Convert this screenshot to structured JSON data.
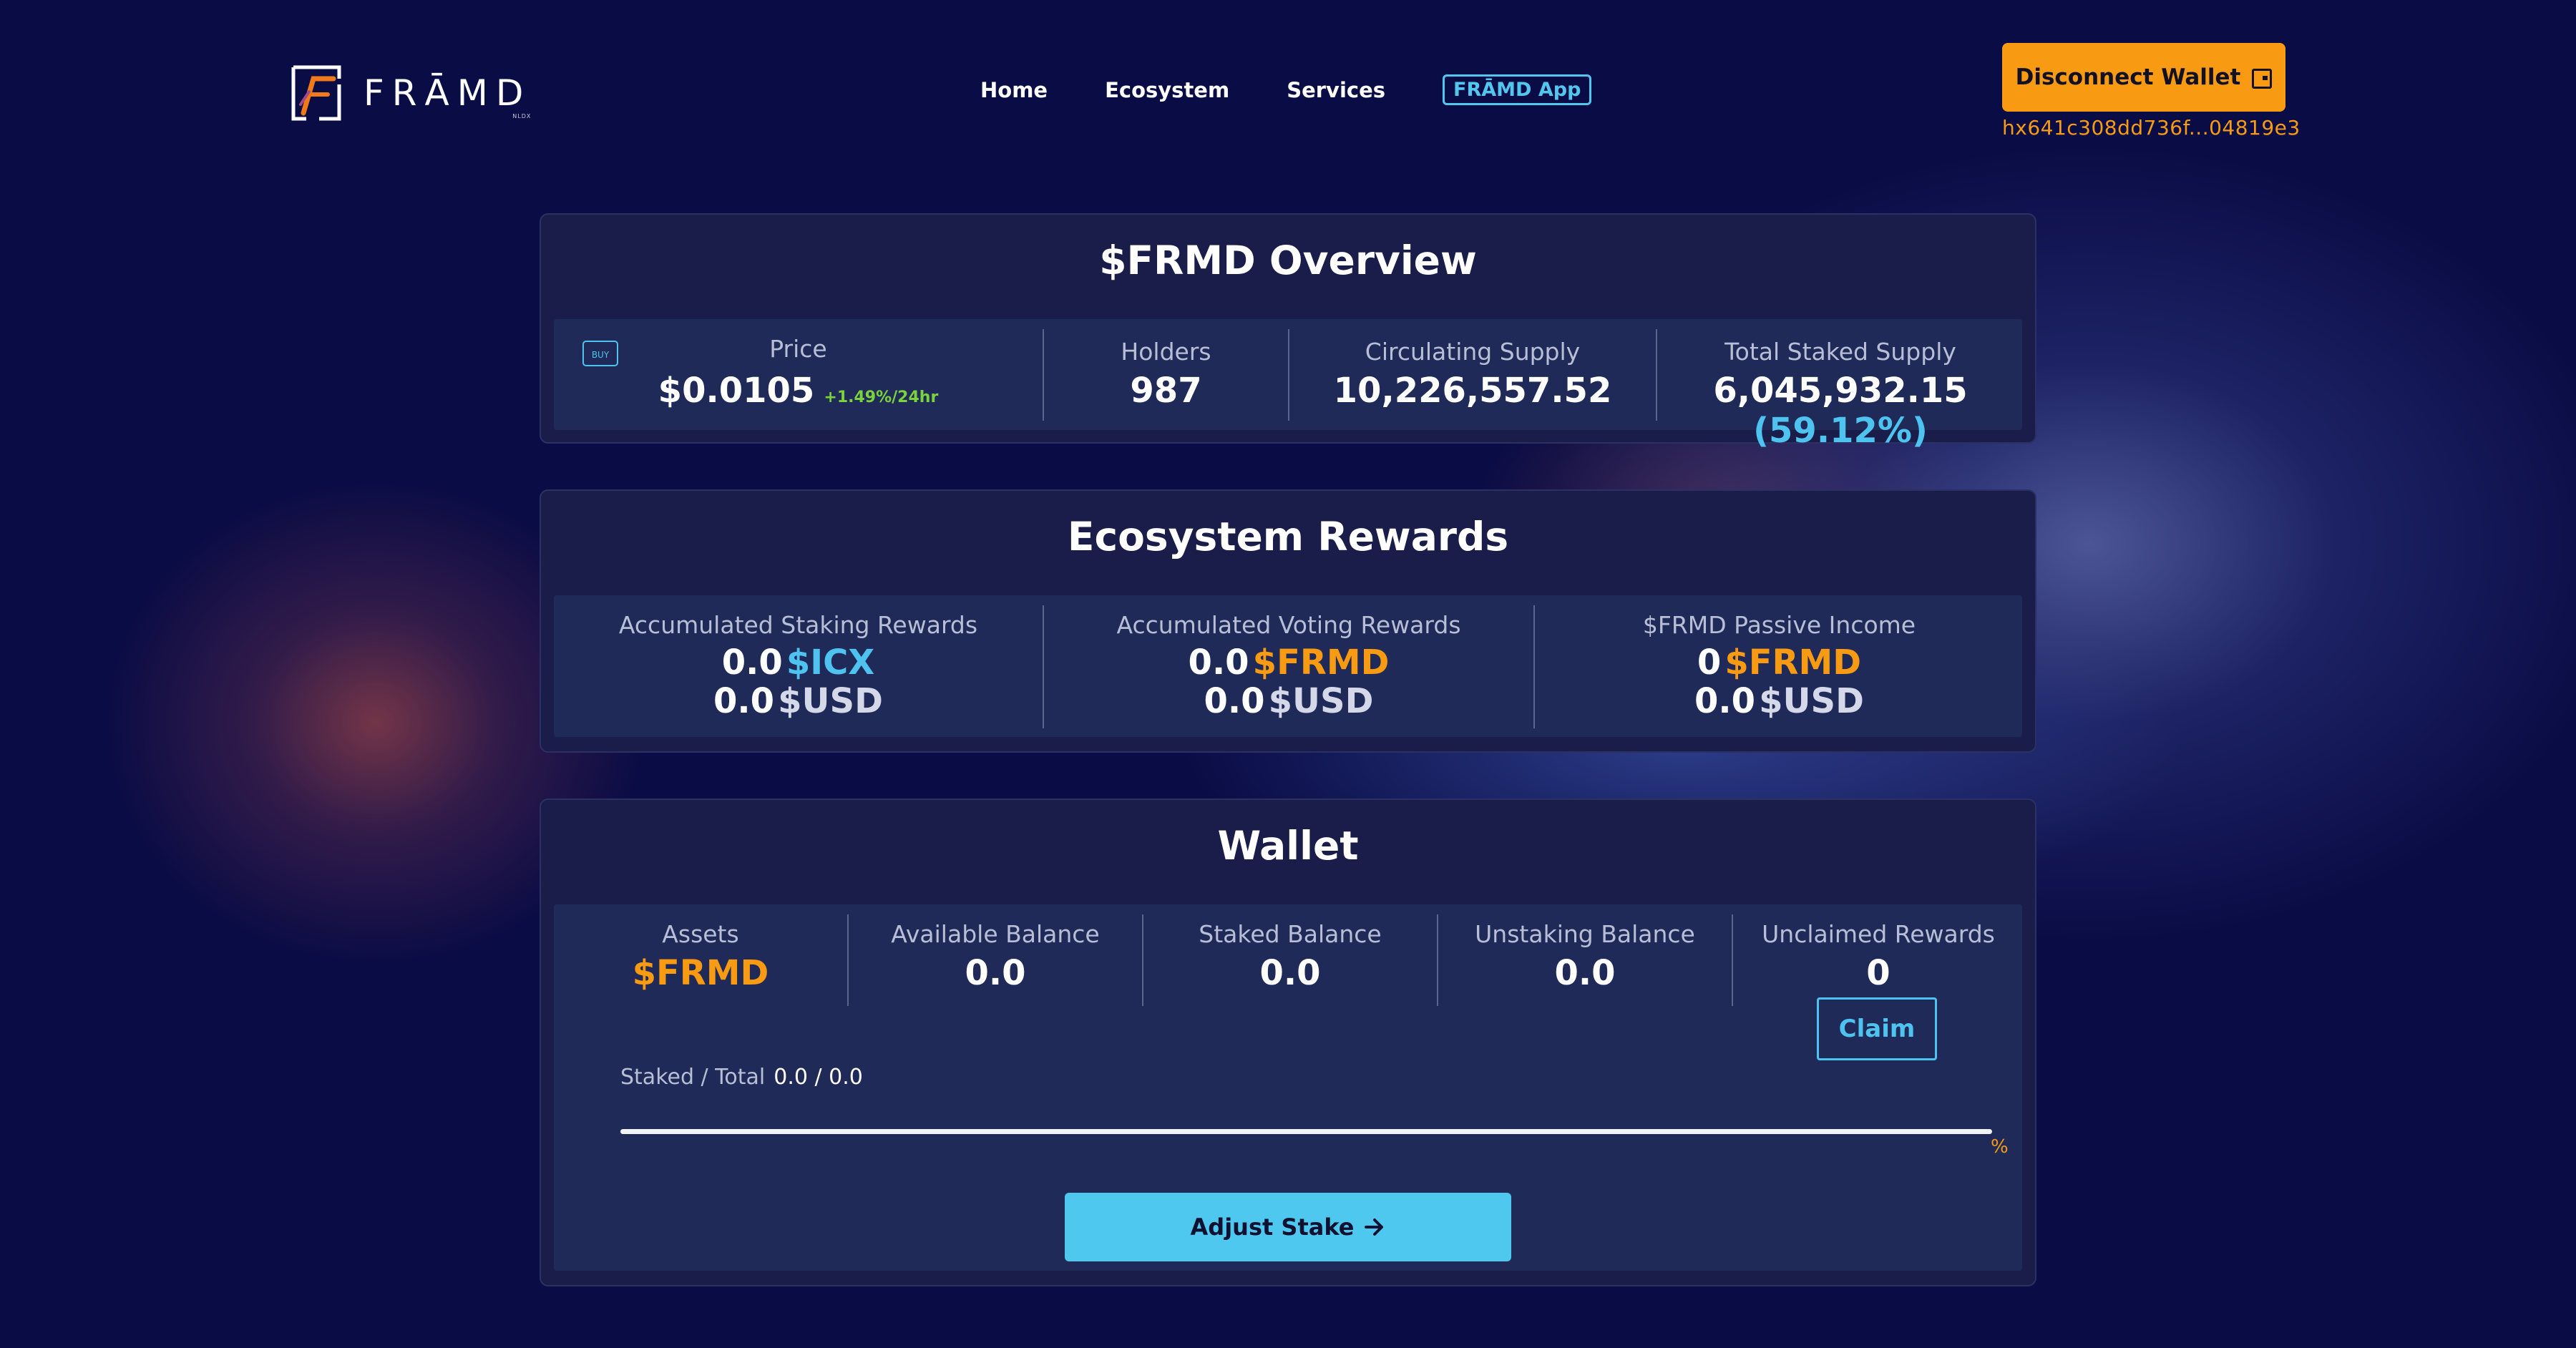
{
  "header": {
    "logo_text": "FRĀMD",
    "logo_subtext": "NLDX",
    "nav": [
      {
        "label": "Home"
      },
      {
        "label": "Ecosystem"
      },
      {
        "label": "Services"
      },
      {
        "label": "FRĀMD App"
      }
    ],
    "wallet_button_label": "Disconnect Wallet",
    "wallet_icon": "wallet-exit-icon",
    "wallet_address": "hx641c308dd736f...04819e3"
  },
  "overview": {
    "title": "$FRMD Overview",
    "buy_label": "BUY",
    "price_label": "Price",
    "price_value": "$0.0105",
    "price_change": "+1.49%/24hr",
    "holders_label": "Holders",
    "holders_value": "987",
    "circ_label": "Circulating Supply",
    "circ_value": "10,226,557.52",
    "staked_label": "Total Staked Supply",
    "staked_value": "6,045,932.15",
    "staked_pct": "(59.12%)"
  },
  "rewards": {
    "title": "Ecosystem Rewards",
    "staking_label": "Accumulated Staking Rewards",
    "staking_amount": "0.0",
    "staking_token": "$ICX",
    "staking_usd_amount": "0.0",
    "staking_usd_unit": "$USD",
    "voting_label": "Accumulated Voting Rewards",
    "voting_amount": "0.0",
    "voting_token": "$FRMD",
    "voting_usd_amount": "0.0",
    "voting_usd_unit": "$USD",
    "passive_label": "$FRMD Passive Income",
    "passive_amount": "0",
    "passive_token": "$FRMD",
    "passive_usd_amount": "0.0",
    "passive_usd_unit": "$USD"
  },
  "wallet": {
    "title": "Wallet",
    "assets_label": "Assets",
    "assets_value": "$FRMD",
    "available_label": "Available Balance",
    "available_value": "0.0",
    "staked_label": "Staked Balance",
    "staked_value": "0.0",
    "unstaking_label": "Unstaking Balance",
    "unstaking_value": "0.0",
    "unclaimed_label": "Unclaimed Rewards",
    "unclaimed_value": "0",
    "claim_label": "Claim",
    "progress_label": "Staked / Total",
    "progress_value": "0.0 / 0.0",
    "progress_fraction": 0.0,
    "progress_unit": "%",
    "adjust_label": "Adjust Stake",
    "adjust_icon": "arrow-right-icon"
  },
  "colors": {
    "accent_orange": "#f89b13",
    "accent_blue": "#4fc3f0",
    "positive_green": "#7ad23c",
    "background": "#0a0c45"
  }
}
